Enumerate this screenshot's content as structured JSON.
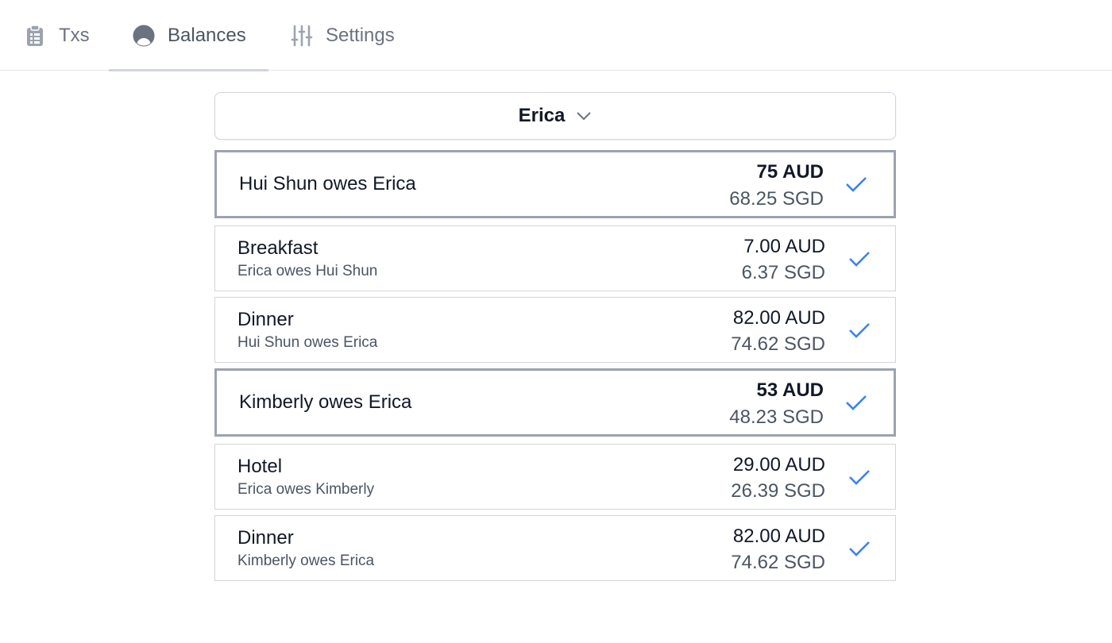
{
  "tabs": [
    {
      "label": "Txs",
      "icon": "clipboard-list-icon"
    },
    {
      "label": "Balances",
      "icon": "user-circle-icon"
    },
    {
      "label": "Settings",
      "icon": "sliders-icon"
    }
  ],
  "person_select": {
    "value": "Erica",
    "icon": "chevron-down-icon"
  },
  "colors": {
    "accent": "#3b82f6",
    "muted": "#6b7280",
    "border": "#d1d5db"
  },
  "balances": [
    {
      "summary": {
        "label": "Hui Shun owes Erica",
        "aud": "75 AUD",
        "sgd": "68.25 SGD"
      },
      "items": [
        {
          "title": "Breakfast",
          "sub": "Erica owes Hui Shun",
          "aud": "7.00 AUD",
          "sgd": "6.37 SGD"
        },
        {
          "title": "Dinner",
          "sub": "Hui Shun owes Erica",
          "aud": "82.00 AUD",
          "sgd": "74.62 SGD"
        }
      ]
    },
    {
      "summary": {
        "label": "Kimberly owes Erica",
        "aud": "53 AUD",
        "sgd": "48.23 SGD"
      },
      "items": [
        {
          "title": "Hotel",
          "sub": "Erica owes Kimberly",
          "aud": "29.00 AUD",
          "sgd": "26.39 SGD"
        },
        {
          "title": "Dinner",
          "sub": "Kimberly owes Erica",
          "aud": "82.00 AUD",
          "sgd": "74.62 SGD"
        }
      ]
    }
  ]
}
